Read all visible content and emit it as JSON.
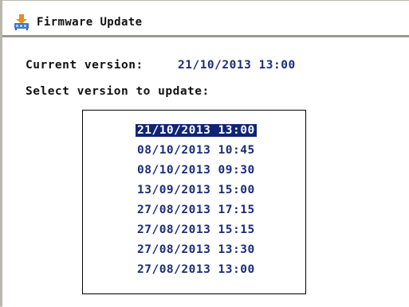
{
  "window": {
    "title": "Firmware Update",
    "icon": "firmware-update-icon"
  },
  "main": {
    "current_label": "Current version:",
    "current_value": "21/10/2013 13:00",
    "select_label": "Select version to update:"
  },
  "versions": {
    "selected_index": 0,
    "items": [
      "21/10/2013 13:00",
      "08/10/2013 10:45",
      "08/10/2013 09:30",
      "13/09/2013 15:00",
      "27/08/2013 17:15",
      "27/08/2013 15:15",
      "27/08/2013 13:30",
      "27/08/2013 13:00"
    ]
  },
  "colors": {
    "value_text": "#1a2c7a",
    "selection_bg": "#0e2673",
    "selection_text": "#ffffff"
  }
}
